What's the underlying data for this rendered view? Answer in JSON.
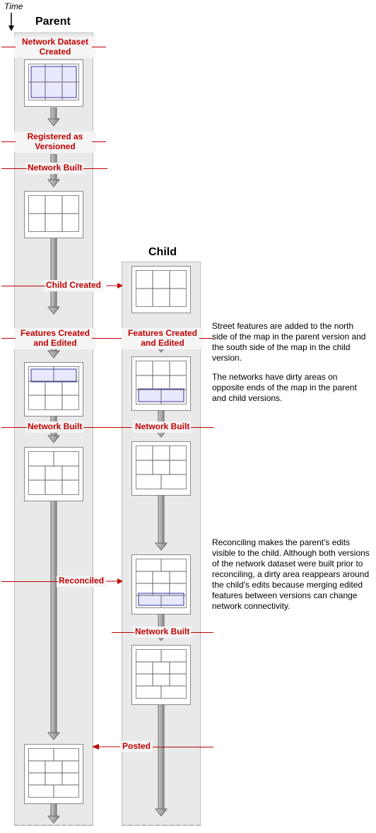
{
  "time_label": "Time",
  "columns": {
    "parent": "Parent",
    "child": "Child"
  },
  "labels": {
    "nd_created": "Network Dataset\nCreated",
    "registered": "Registered as\nVersioned",
    "net_built": "Network Built",
    "child_created": "Child Created",
    "feat_edited": "Features Created\nand Edited",
    "reconciled": "Reconciled",
    "posted": "Posted"
  },
  "desc": {
    "d1": "Street features are added to the north side of the map in the parent version and the south side of the map in the child version.",
    "d2": "The networks have dirty areas on opposite ends of the map in the parent and child versions.",
    "d3": "Reconciling makes the parent's edits visible to the child. Although both versions of the network dataset were built prior to reconciling, a dirty area reappears around the child's edits because merging edited features between versions can change network connectivity."
  }
}
